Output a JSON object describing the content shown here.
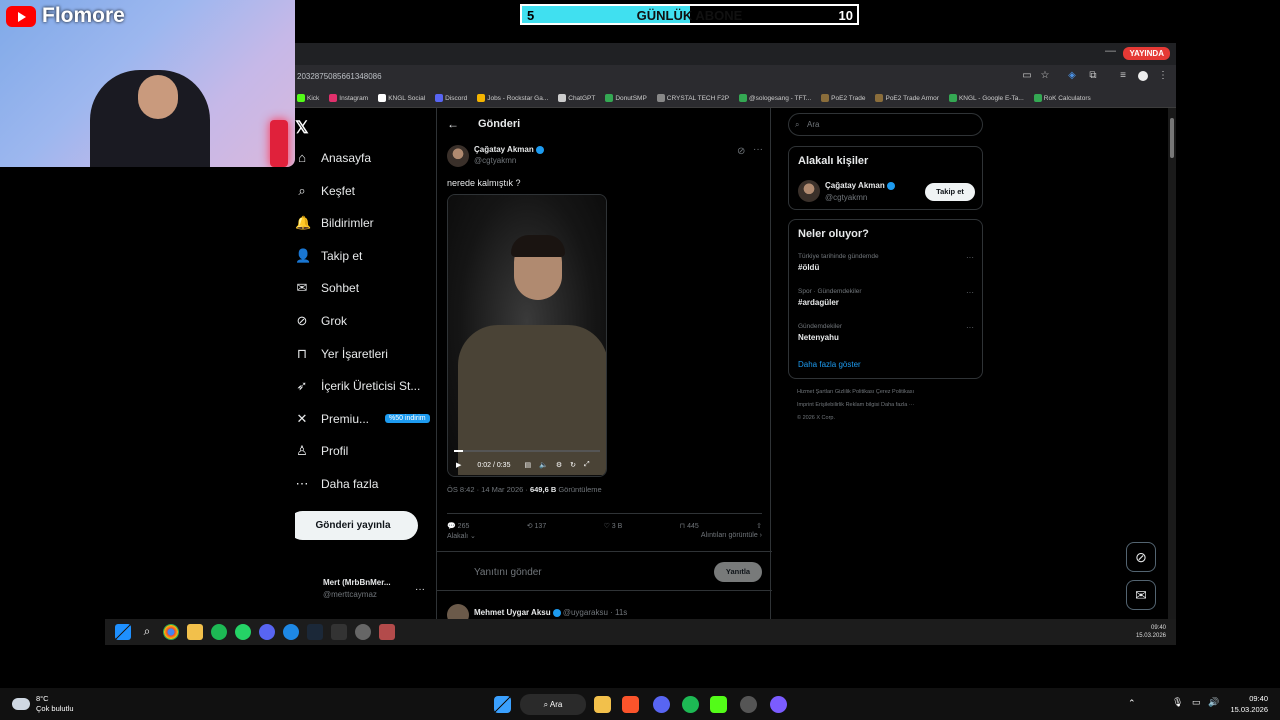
{
  "overlay": {
    "goal_start": "5",
    "goal_label": "GÜNLÜK ABONE",
    "goal_end": "10",
    "goal_progress": 0.5,
    "brand": "Flomore"
  },
  "browser": {
    "live_badge": "YAYINDA",
    "url": "2032875085661348086",
    "bookmarks": [
      {
        "label": "Kick",
        "color": "#53fc18"
      },
      {
        "label": "Instagram",
        "color": "#e1306c"
      },
      {
        "label": "KNGL Social",
        "color": "#ffffff"
      },
      {
        "label": "Discord",
        "color": "#5865f2"
      },
      {
        "label": "Jobs - Rockstar Ga...",
        "color": "#f4b400"
      },
      {
        "label": "ChatGPT",
        "color": "#cccccc"
      },
      {
        "label": "DonutSMP",
        "color": "#34a853"
      },
      {
        "label": "CRYSTAL TECH F2P",
        "color": "#888888"
      },
      {
        "label": "@sologesang - TFT...",
        "color": "#34a853"
      },
      {
        "label": "PoE2 Trade",
        "color": "#8a6d3b"
      },
      {
        "label": "PoE2 Trade Armor",
        "color": "#8a6d3b"
      },
      {
        "label": "KNGL - Google E-Ta...",
        "color": "#34a853"
      },
      {
        "label": "RoK Calculators",
        "color": "#34a853"
      }
    ]
  },
  "nav": {
    "items": [
      {
        "label": "Anasayfa",
        "icon": "home-icon",
        "glyph": "⌂"
      },
      {
        "label": "Keşfet",
        "icon": "search-icon",
        "glyph": "⌕"
      },
      {
        "label": "Bildirimler",
        "icon": "bell-icon",
        "glyph": "🔔"
      },
      {
        "label": "Takip et",
        "icon": "add-person-icon",
        "glyph": "👤"
      },
      {
        "label": "Sohbet",
        "icon": "mail-icon",
        "glyph": "✉"
      },
      {
        "label": "Grok",
        "icon": "grok-icon",
        "glyph": "⊘"
      },
      {
        "label": "Yer İşaretleri",
        "icon": "bookmark-icon",
        "glyph": "⊓"
      },
      {
        "label": "İçerik Üreticisi St...",
        "icon": "rocket-icon",
        "glyph": "➶"
      },
      {
        "label": "Premiu...",
        "icon": "x-premium-icon",
        "glyph": "✕"
      },
      {
        "label": "Profil",
        "icon": "profile-icon",
        "glyph": "♙"
      },
      {
        "label": "Daha fazla",
        "icon": "more-circle-icon",
        "glyph": "⋯"
      }
    ],
    "premium_badge": "%50 indirim",
    "post_button": "Gönderi yayınla",
    "account_name": "Mert (MrbBnMer...",
    "account_handle": "@merttcaymaz",
    "account_more": "···"
  },
  "post": {
    "header_title": "Gönderi",
    "author": "Çağatay Akman",
    "handle": "@cgtyakmn",
    "text": "nerede kalmıştık ?",
    "video_time": "0:02 / 0:35",
    "video_progress": 0.06,
    "meta_time": "ÖS 8:42 · 14 Mar 2026 ·",
    "meta_views": "649,6 B",
    "meta_views_label": "Görüntüleme",
    "replies": "265",
    "reposts": "137",
    "likes": "3 B",
    "bookmarks": "445",
    "sort_label": "Alakalı",
    "quotes_link": "Alıntıları görüntüle",
    "reply_placeholder": "Yanıtını gönder",
    "reply_button": "Yanıtla",
    "next_author": "Mehmet Uygar Aksu",
    "next_handle": "@uygaraksu · 11s"
  },
  "sidebar": {
    "search_placeholder": "Ara",
    "people_title": "Alakalı kişiler",
    "person_name": "Çağatay Akman",
    "person_handle": "@cgtyakmn",
    "follow_button": "Takip et",
    "trends_title": "Neler oluyor?",
    "trends": [
      {
        "context": "Türkiye tarihinde gündemde",
        "name": "#öldü"
      },
      {
        "context": "Spor · Gündemdekiler",
        "name": "#ardagüler"
      },
      {
        "context": "Gündemdekiler",
        "name": "Netenyahu"
      }
    ],
    "show_more": "Daha fazla göster",
    "footer_lines": [
      "Hizmet Şartları   Gizlilik Politikası   Çerez Politikası",
      "Imprint   Erişilebilirlik   Reklam bilgisi   Daha fazla ···",
      "© 2026 X Corp."
    ]
  },
  "inner_taskbar": {
    "time": "09:40",
    "date": "15.03.2026"
  },
  "outer_taskbar": {
    "temp": "8°C",
    "weather": "Çok bulutlu",
    "search": "Ara",
    "time": "09:40",
    "date": "15.03.2026"
  }
}
